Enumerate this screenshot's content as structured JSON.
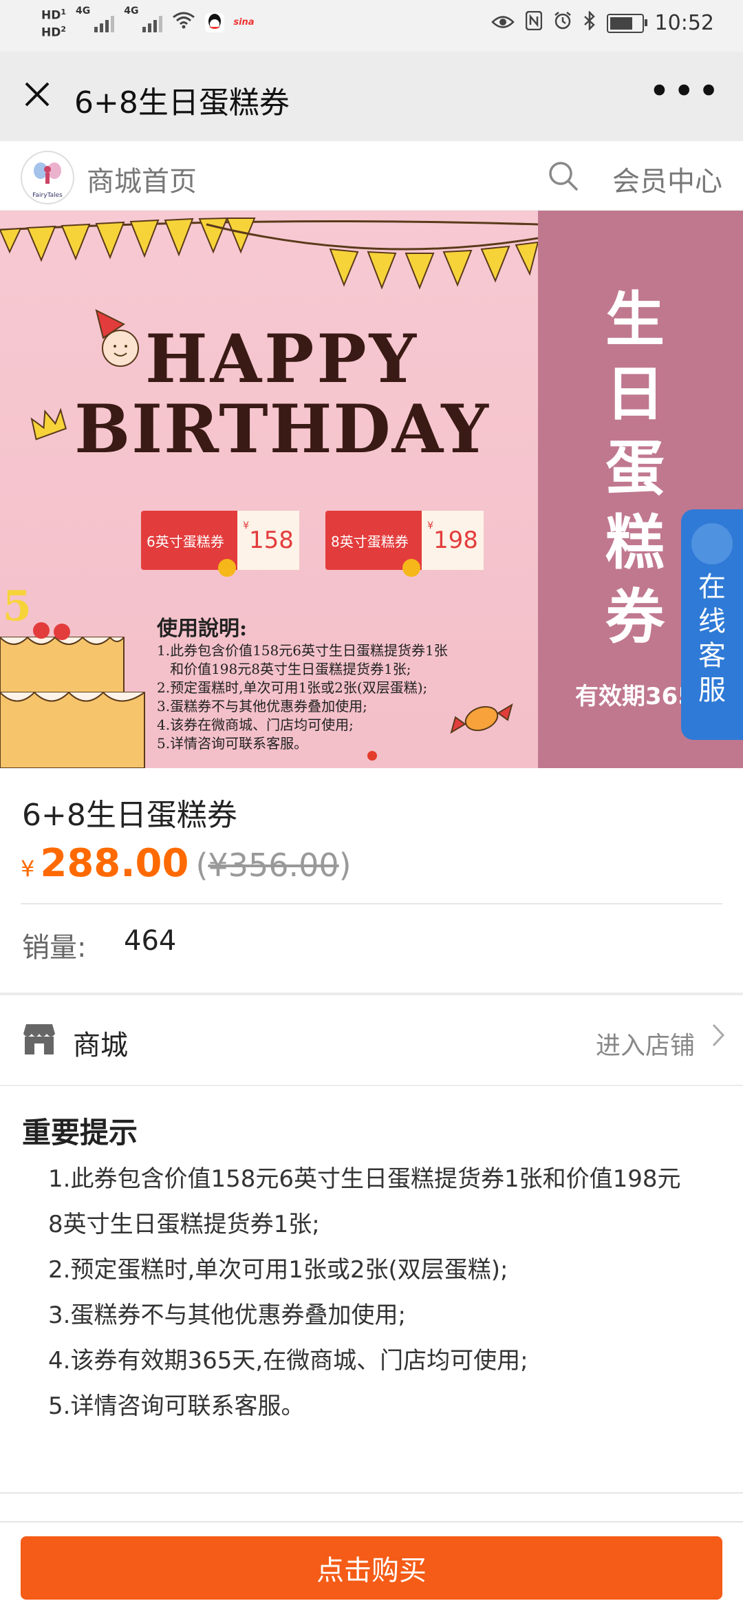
{
  "status_bar": {
    "hd1": "HD",
    "hd1_sub": "1",
    "hd2": "HD",
    "hd2_sub": "2",
    "net1": "4G",
    "net2": "4G",
    "app_icon_sina": "sina",
    "time": "10:52",
    "icons": [
      "hd-icon",
      "signal-icon",
      "wifi-icon",
      "qq-icon",
      "weibo-icon",
      "eye-icon",
      "nfc-icon",
      "alarm-icon",
      "bluetooth-icon",
      "battery-icon"
    ]
  },
  "nav": {
    "title": "6+8生日蛋糕券",
    "more": "•••"
  },
  "shop_bar": {
    "logo_text": "FairyTales",
    "home_label": "商城首页",
    "member_label": "会员中心"
  },
  "banner": {
    "happy": "HAPPY",
    "birthday": "BIRTHDAY",
    "coupons": [
      {
        "name": "6英寸蛋糕券",
        "symbol": "¥",
        "value": "158"
      },
      {
        "name": "8英寸蛋糕券",
        "symbol": "¥",
        "value": "198"
      }
    ],
    "instruction_title": "使用說明:",
    "instructions": [
      "1.此券包含价值158元6英寸生日蛋糕提货券1张",
      "   和价值198元8英寸生日蛋糕提货券1张;",
      "2.预定蛋糕时,单次可用1张或2张(双层蛋糕);",
      "3.蛋糕券不与其他优惠券叠加使用;",
      "4.该券在微商城、门店均可使用;",
      "5.详情咨询可联系客服。"
    ],
    "side_title": [
      "生",
      "日",
      "蛋",
      "糕",
      "券"
    ],
    "side_validity": "有效期365",
    "cake_number": "5",
    "colors": {
      "side": "#c0788f",
      "pink": "#f5c4ce"
    }
  },
  "service": {
    "chars": [
      "在",
      "线",
      "客",
      "服"
    ]
  },
  "product": {
    "title": "6+8生日蛋糕券",
    "price_symbol": "¥",
    "price": "288.00",
    "original_open": "(",
    "original_price": "¥356.00",
    "original_close": ")",
    "sales_label": "销量:",
    "sales_value": "464",
    "accent": "#ff6a00"
  },
  "store": {
    "name": "商城",
    "enter_label": "进入店铺"
  },
  "tips": {
    "title": "重要提示",
    "lines": [
      "1.此券包含价值158元6英寸生日蛋糕提货券1张和价值198元",
      "8英寸生日蛋糕提货券1张;",
      "2.预定蛋糕时,单次可用1张或2张(双层蛋糕);",
      "3.蛋糕券不与其他优惠券叠加使用;",
      "4.该券有效期365天,在微商城、门店均可使用;",
      "5.详情咨询可联系客服。"
    ]
  },
  "bottom": {
    "buy_label": "点击购买",
    "buy_color": "#f45c17"
  }
}
